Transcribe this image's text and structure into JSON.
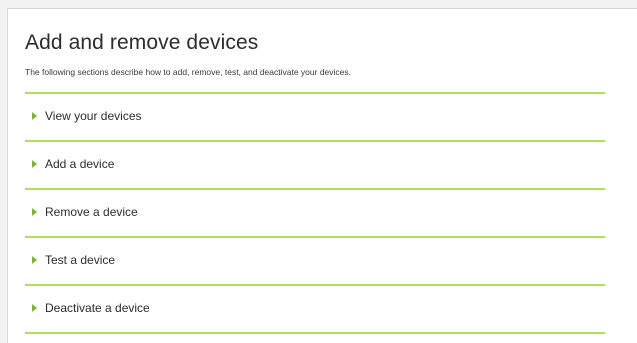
{
  "page": {
    "title": "Add and remove devices",
    "description": "The following sections describe how to add, remove, test, and deactivate your devices."
  },
  "sections": [
    {
      "label": "View your devices",
      "icon": "expand-arrow-icon"
    },
    {
      "label": "Add a device",
      "icon": "expand-arrow-icon"
    },
    {
      "label": "Remove a device",
      "icon": "expand-arrow-icon"
    },
    {
      "label": "Test a device",
      "icon": "expand-arrow-icon"
    },
    {
      "label": "Deactivate a device",
      "icon": "expand-arrow-icon"
    }
  ],
  "colors": {
    "accent_line": "#b5dd5a",
    "arrow": "#7ab82b",
    "text": "#2d2d2d"
  }
}
